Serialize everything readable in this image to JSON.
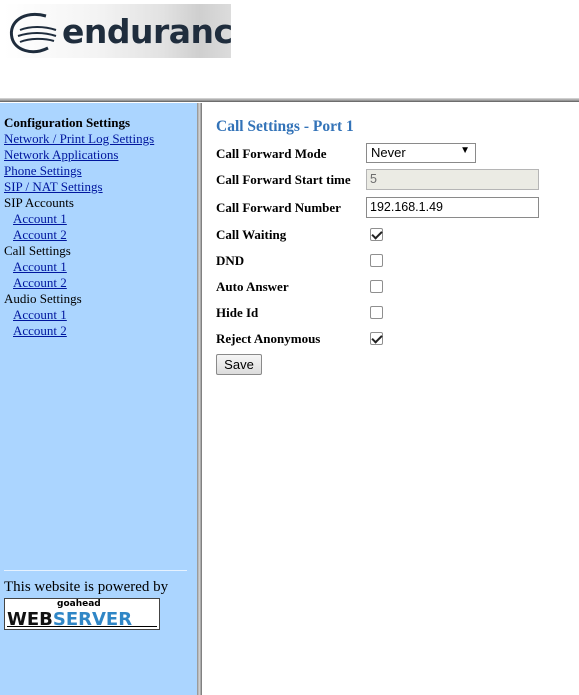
{
  "header": {
    "logo_text": "endurance"
  },
  "sidebar": {
    "heading": "Configuration Settings",
    "links": [
      {
        "label": "Network / Print Log Settings"
      },
      {
        "label": "Network Applications"
      },
      {
        "label": "Phone Settings"
      },
      {
        "label": "SIP / NAT Settings"
      }
    ],
    "groups": [
      {
        "label": "SIP Accounts",
        "items": [
          "Account 1",
          "Account 2"
        ]
      },
      {
        "label": "Call Settings",
        "items": [
          "Account 1",
          "Account 2"
        ]
      },
      {
        "label": "Audio Settings",
        "items": [
          "Account 1",
          "Account 2"
        ]
      }
    ],
    "powered_by": "This website is powered by",
    "badge": {
      "top": "goahead",
      "left": "WEB",
      "right": "SERVER"
    }
  },
  "main": {
    "title": "Call Settings - Port 1",
    "fields": {
      "forward_mode": {
        "label": "Call Forward Mode",
        "value": "Never"
      },
      "forward_start": {
        "label": "Call Forward Start time",
        "value": "5"
      },
      "forward_number": {
        "label": "Call Forward Number",
        "value": "192.168.1.49"
      },
      "call_waiting": {
        "label": "Call Waiting",
        "checked": true
      },
      "dnd": {
        "label": "DND",
        "checked": false
      },
      "auto_answer": {
        "label": "Auto Answer",
        "checked": false
      },
      "hide_id": {
        "label": "Hide Id",
        "checked": false
      },
      "reject_anonymous": {
        "label": "Reject Anonymous",
        "checked": true
      }
    },
    "save_label": "Save"
  },
  "colors": {
    "sidebar_bg": "#abd5ff",
    "title": "#3373b8",
    "link": "#00169e"
  }
}
